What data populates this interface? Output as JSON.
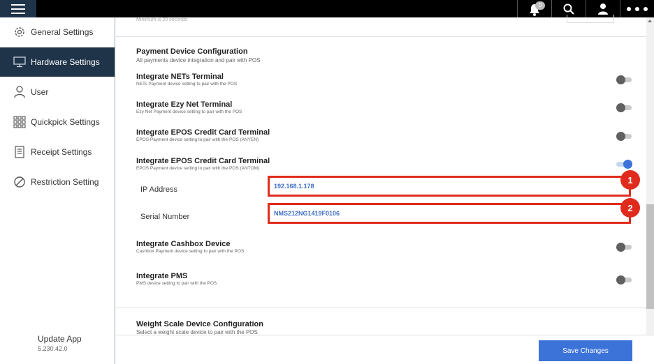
{
  "topbar": {
    "notification_count": "0",
    "icons": [
      "menu-icon",
      "bell-icon",
      "search-icon",
      "user-icon",
      "more-icon"
    ]
  },
  "sidebar": {
    "items": [
      {
        "label": "General Settings",
        "icon": "gear-icon"
      },
      {
        "label": "Hardware Settings",
        "icon": "monitor-icon",
        "active": true
      },
      {
        "label": "User",
        "icon": "user-icon"
      },
      {
        "label": "Quickpick Settings",
        "icon": "grid-icon"
      },
      {
        "label": "Receipt Settings",
        "icon": "receipt-icon"
      },
      {
        "label": "Restriction Setting",
        "icon": "restriction-icon"
      }
    ],
    "update_title": "Update App",
    "version": "5.230.42.0"
  },
  "main": {
    "previous_hint": "Minimum is 20 seconds",
    "payment_section": {
      "title": "Payment Device Configuration",
      "subtitle": "All payments device integration and pair with POS"
    },
    "rows": [
      {
        "title": "Integrate NETs Terminal",
        "sub": "NETs Payment device setting to pair with the POS",
        "on": false
      },
      {
        "title": "Integrate Ezy Net Terminal",
        "sub": "Ezy Net Payment device setting to pair with the POS",
        "on": false
      },
      {
        "title": "Integrate EPOS Credit Card Terminal",
        "sub": "EPOS Payment device setting to pair with the POS (ANYEN)",
        "on": false
      },
      {
        "title": "Integrate EPOS Credit Card Terminal",
        "sub": "EPOS Payment device setting to pair with the POS (ANTOM)",
        "on": true
      },
      {
        "title": "Integrate Cashbox Device",
        "sub": "Cashbox Payment device setting to pair with the POS",
        "on": false
      },
      {
        "title": "Integrate PMS",
        "sub": "PMS device setting to pair with the POS",
        "on": false
      }
    ],
    "fields": {
      "ip_label": "IP Address",
      "ip_value": "192.168.1.178",
      "serial_label": "Serial Number",
      "serial_value": "NMS212NG1419F0106"
    },
    "callouts": [
      "1",
      "2"
    ],
    "weight_section": {
      "title": "Weight Scale Device Configuration",
      "subtitle": "Select a weight scale device to pair with the POS"
    }
  },
  "footer": {
    "save_label": "Save Changes"
  },
  "colors": {
    "accent": "#3b73d9",
    "sidebar_active": "#1f3349",
    "highlight": "#e02b1c"
  }
}
